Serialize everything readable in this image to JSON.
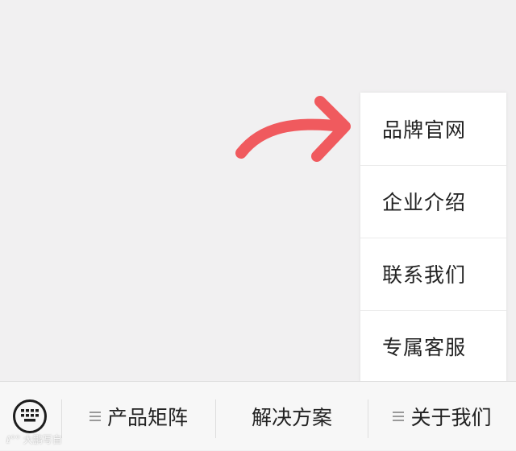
{
  "popup_menu": {
    "items": [
      {
        "label": "品牌官网"
      },
      {
        "label": "企业介绍"
      },
      {
        "label": "联系我们"
      },
      {
        "label": "专属客服"
      }
    ]
  },
  "bottom_bar": {
    "items": [
      {
        "label": "产品矩阵",
        "has_submenu": true
      },
      {
        "label": "解决方案",
        "has_submenu": false
      },
      {
        "label": "关于我们",
        "has_submenu": true
      }
    ]
  },
  "watermark": {
    "text": "大鹏写自"
  },
  "icons": {
    "keyboard": "keyboard-icon",
    "arrow": "curved-arrow-icon",
    "submenu": "menu-lines-icon",
    "watermark": "watermark-logo-icon"
  },
  "colors": {
    "arrow": "#f05a5e",
    "background": "#f1f0f1",
    "menu_bg": "#ffffff",
    "bar_bg": "#f7f7f7",
    "text": "#222222"
  }
}
